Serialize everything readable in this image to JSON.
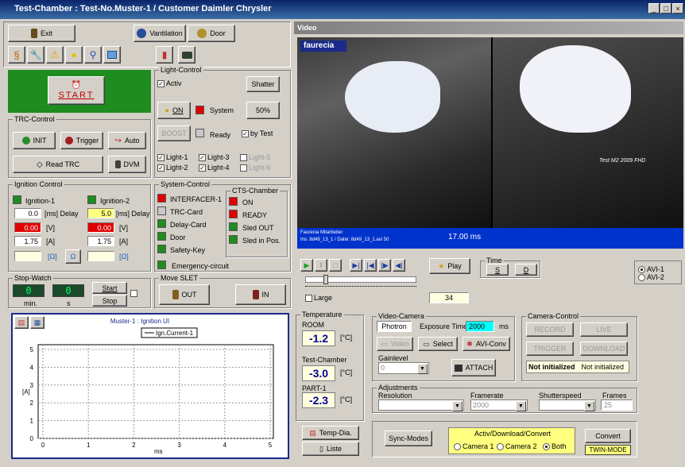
{
  "window": {
    "title": "Test-Chamber : Test-No.Muster-1  /  Customer Daimler Chrysler",
    "controls": [
      "_",
      "□",
      "×"
    ]
  },
  "top_buttons": {
    "exit": "Exit",
    "ventilation": "Vantilation",
    "door": "Door"
  },
  "start": {
    "label": "START"
  },
  "trc_control": {
    "title": "TRC-Control",
    "init": "INIT",
    "trigger": "Trigger",
    "auto": "Auto",
    "read_trc": "Read TRC",
    "dvm": "DVM"
  },
  "light_control": {
    "title": "Light-Control",
    "activ": "Activ",
    "shatter": "Shatter",
    "on": "ON",
    "system": "System",
    "percent": "50%",
    "boost": "BOOST",
    "ready": "Ready",
    "by_test": "by Test",
    "lights": [
      "Light-1",
      "Light-3",
      "Light-5",
      "Light-2",
      "Light-4",
      "Light-6"
    ]
  },
  "ignition": {
    "title": "Ignition Control",
    "ign1": {
      "name": "Ignition-1",
      "delay": "0.0",
      "volt": "0.00",
      "amp": "1.75",
      "ohm": ""
    },
    "ign2": {
      "name": "Ignition-2",
      "delay": "5.0",
      "volt": "0.00",
      "amp": "1.75",
      "ohm": ""
    },
    "delay_unit": "[ms] Delay",
    "volt_unit": "[V]",
    "amp_unit": "[A]",
    "ohm_unit": "[Ω]",
    "ohm_btn": "Ω"
  },
  "system_control": {
    "title": "System-Control",
    "items": [
      "INTERFACER-1",
      "TRC-Card",
      "Delay-Card",
      "Door",
      "Safety-Key"
    ],
    "emergency": "Emergency-circuit"
  },
  "cts": {
    "title": "CTS-Chamber",
    "items": [
      "ON",
      "READY",
      "Sled OUT",
      "Sled in Pos."
    ]
  },
  "stopwatch": {
    "title": "Stop-Watch",
    "min": "0",
    "sec": "0",
    "min_label": "min.",
    "sec_label": "s",
    "start": "Start",
    "stop": "Stop"
  },
  "move_slet": {
    "title": "Move SLET",
    "out": "OUT",
    "in": "IN"
  },
  "graph": {
    "title": "Muster-1 : Ignition UI",
    "legend": "Ign.Current-1",
    "ylabel": "[A]",
    "xlabel": "ms",
    "yticks": [
      "5",
      "4",
      "3",
      "2",
      "1",
      "0"
    ],
    "xticks": [
      "0",
      "1",
      "2",
      "3",
      "4",
      "5"
    ]
  },
  "video": {
    "title": "Video",
    "brand": "faurecia",
    "time": "17.00 ms",
    "info1": "Faurecia Mitarbeiter",
    "info2": "Ins: 8d49_13_1 / Datei: 8d49_13_1.avi   50",
    "overlay": "Test M2 2009 FHD"
  },
  "playback": {
    "play": "Play",
    "time_title": "Time",
    "s": "S",
    "d": "D",
    "large": "Large",
    "frame": "34",
    "avi1": "AVI-1",
    "avi2": "AVI-2"
  },
  "temperature": {
    "title": "Temperature",
    "room_label": "ROOM",
    "room": "-1.2",
    "chamber_label": "Test-Chamber",
    "chamber": "-3.0",
    "part_label": "PART-1",
    "part": "-2.3",
    "unit": "[°C]",
    "temp_dia": "Temp-Dia.",
    "liste": "Liste"
  },
  "video_camera": {
    "title": "Video-Camera",
    "camera": "Photron",
    "exposure_label": "Exposure Time",
    "exposure": "2000",
    "exposure_unit": "ms",
    "video_btn": "Video",
    "select_btn": "Select",
    "aviconv_btn": "AVI-Conv",
    "gain_label": "Gainlevel",
    "gain": "0",
    "attach": "ATTACH"
  },
  "camera_control": {
    "title": "Camera-Control",
    "record": "RECORD",
    "live": "LIVE",
    "trigger": "TRIGGER",
    "download": "DOWNLOAD",
    "status1": "Not initialized",
    "status2": "Not initialized"
  },
  "adjustments": {
    "title": "Adjustments",
    "resolution": "Resolution",
    "framerate": "Framerate",
    "framerate_val": "2000",
    "shutter": "Shutterspeed",
    "frames": "Frames",
    "frames_val": "25"
  },
  "bottom": {
    "sync": "Sync-Modes",
    "adc_title": "Activ/Download/Convert",
    "cam1": "Camera 1",
    "cam2": "Camera 2",
    "both": "Both",
    "convert": "Convert",
    "twin": "TWIN-MODE"
  }
}
